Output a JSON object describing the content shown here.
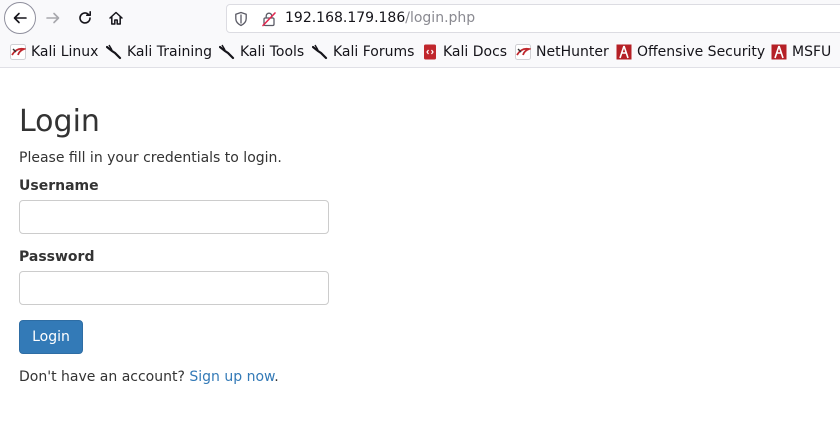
{
  "browser": {
    "url_host": "192.168.179.186",
    "url_path": "/login.php",
    "bookmarks": [
      {
        "label": "Kali Linux",
        "icon": "kali-dragon-red-icon"
      },
      {
        "label": "Kali Training",
        "icon": "kali-dragon-icon"
      },
      {
        "label": "Kali Tools",
        "icon": "kali-dragon-icon"
      },
      {
        "label": "Kali Forums",
        "icon": "kali-dragon-icon"
      },
      {
        "label": "Kali Docs",
        "icon": "kali-docs-icon"
      },
      {
        "label": "NetHunter",
        "icon": "kali-dragon-red-icon"
      },
      {
        "label": "Offensive Security",
        "icon": "offsec-icon"
      },
      {
        "label": "MSFU",
        "icon": "offsec-icon"
      }
    ]
  },
  "page": {
    "title": "Login",
    "subtitle": "Please fill in your credentials to login.",
    "username_label": "Username",
    "username_value": "",
    "password_label": "Password",
    "password_value": "",
    "login_button": "Login",
    "signup_prompt": "Don't have an account?",
    "signup_link": "Sign up now",
    "signup_suffix": "."
  },
  "colors": {
    "primary": "#337ab7",
    "text": "#333333",
    "chrome_bg": "#f9f9fb"
  }
}
